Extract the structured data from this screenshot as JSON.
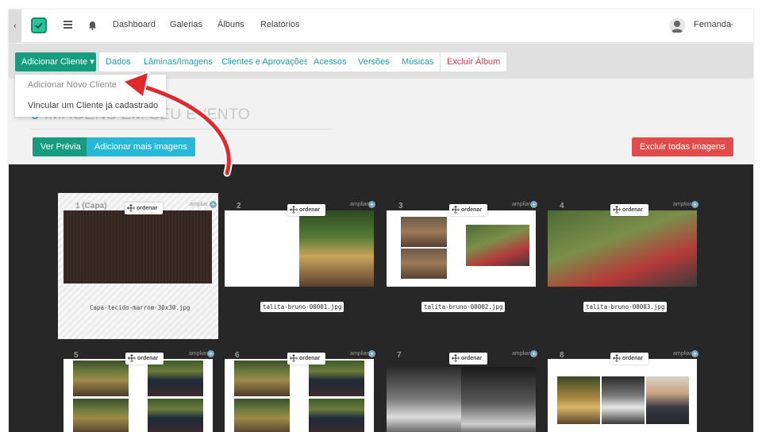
{
  "topbar": {
    "back_icon": "‹",
    "nav": [
      "Dashboard",
      "Galerias",
      "Álbuns",
      "Relatórios"
    ],
    "user": "Fernanda",
    "user_chevron": "⌄"
  },
  "tabs": {
    "add_client": "Adicionar Cliente ▾",
    "items": [
      "Dados",
      "Lâminas/Imagens",
      "Clientes e Aprovações",
      "Acessos",
      "Versões",
      "Músicas"
    ],
    "delete_album": "Excluir Álbum"
  },
  "dropdown": {
    "items": [
      "Adicionar Novo Cliente",
      "Vincular um Cliente já cadastrado"
    ]
  },
  "heading": {
    "count": "9",
    "text": " IMAGENS EM SEU EVENTO"
  },
  "buttons": {
    "preview": "Ver Prévia",
    "add_more": "Adicionar mais imagens",
    "delete_all": "Excluir todas imagens"
  },
  "gallery": {
    "ordenar": "ordenar",
    "ampliar": "ampliar",
    "plus": "+",
    "cards": [
      {
        "num": "1 (Capa)",
        "file": "Capa-tecido-marrom-30x30.jpg"
      },
      {
        "num": "2",
        "file": "talita-bruno-00001.jpg"
      },
      {
        "num": "3",
        "file": "talita-bruno-00002.jpg"
      },
      {
        "num": "4",
        "file": "talita-bruno-00003.jpg"
      },
      {
        "num": "5",
        "file": ""
      },
      {
        "num": "6",
        "file": ""
      },
      {
        "num": "7",
        "file": ""
      },
      {
        "num": "8",
        "file": ""
      }
    ]
  },
  "colors": {
    "primary": "#169d80",
    "tab_text": "#19a0a6",
    "danger": "#e04b4b",
    "info": "#26b8d6",
    "arrow": "#e0292b"
  },
  "icons": [
    "chevron-left-icon",
    "logo-check-icon",
    "menu-icon",
    "bell-icon",
    "avatar-user-icon",
    "move-arrows-icon",
    "plus-icon"
  ]
}
